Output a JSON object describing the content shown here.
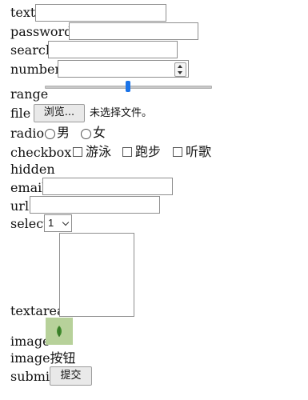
{
  "labels": {
    "text": "text",
    "password": "password",
    "search": "search",
    "number": "number",
    "range": "range",
    "file": "file",
    "radio": "radio",
    "checkbox": "checkbox",
    "hidden": "hidden",
    "email": "email",
    "url": "url",
    "select": "select",
    "textarea": "textarea",
    "image": "image",
    "image_button": "image按钮",
    "submit": "submit"
  },
  "inputs": {
    "text": "",
    "password": "",
    "search": "",
    "number": "",
    "email": "",
    "url": ""
  },
  "range": {
    "value": 0.5
  },
  "file": {
    "browse_label": "浏览...",
    "status": "未选择文件。"
  },
  "radio_options": [
    "男",
    "女"
  ],
  "checkbox_options": [
    "游泳",
    "跑步",
    "听歌"
  ],
  "select": {
    "selected": "1"
  },
  "submit": {
    "label": "提交"
  },
  "colors": {
    "range_thumb": "#1a73e8",
    "image_bg": "#b7d19a"
  },
  "icons": {
    "image": "leaf-icon",
    "number_spinner": "spinner-icon",
    "select_arrow": "chevron-down-icon"
  }
}
